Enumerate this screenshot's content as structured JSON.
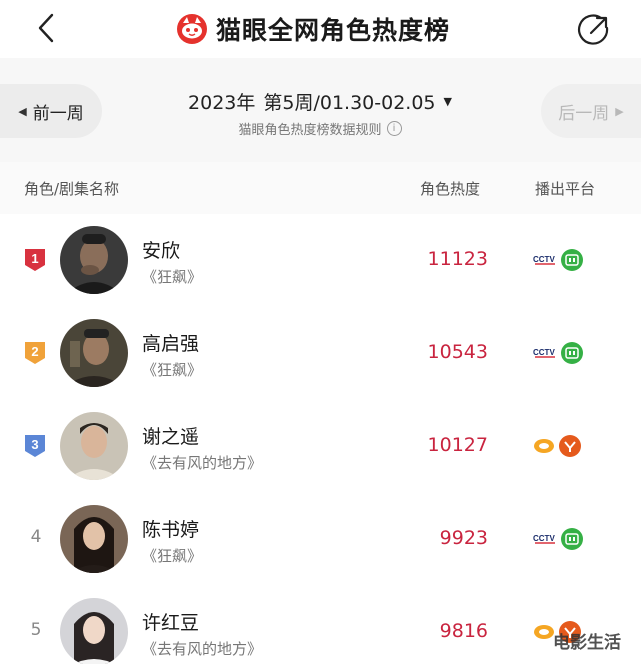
{
  "header": {
    "title": "猫眼全网角色热度榜",
    "back_icon": "chevron-left-icon",
    "share_icon": "share-icon",
    "logo_icon": "maoyan-cat-logo-icon",
    "brand_color": "#e5322d"
  },
  "week": {
    "prev_label": "前一周",
    "next_label": "后一周",
    "year": "2023年",
    "range": "第5周/01.30-02.05",
    "rule_text": "猫眼角色热度榜数据规则",
    "info_glyph": "i"
  },
  "table": {
    "col_name": "角色/剧集名称",
    "col_heat": "角色热度",
    "col_platform": "播出平台"
  },
  "rows": [
    {
      "rank": "1",
      "name": "安欣",
      "drama": "《狂飙》",
      "heat": "11123",
      "badge_color": "#d8323f",
      "platforms": [
        "cctv-icon",
        "iqiyi-icon"
      ]
    },
    {
      "rank": "2",
      "name": "高启强",
      "drama": "《狂飙》",
      "heat": "10543",
      "badge_color": "#f0a23a",
      "platforms": [
        "cctv-icon",
        "iqiyi-icon"
      ]
    },
    {
      "rank": "3",
      "name": "谢之遥",
      "drama": "《去有风的地方》",
      "heat": "10127",
      "badge_color": "#5b86d6",
      "platforms": [
        "mango-tv-icon",
        "youku-icon"
      ]
    },
    {
      "rank": "4",
      "name": "陈书婷",
      "drama": "《狂飙》",
      "heat": "9923",
      "platforms": [
        "cctv-icon",
        "iqiyi-icon"
      ]
    },
    {
      "rank": "5",
      "name": "许红豆",
      "drama": "《去有风的地方》",
      "heat": "9816",
      "platforms": [
        "mango-tv-icon",
        "youku-icon"
      ]
    }
  ],
  "watermark": "电影生活",
  "colors": {
    "heat": "#c9243f",
    "iqiyi": "#35b045",
    "youku": "#e55a1c",
    "mango": "#f5a623"
  }
}
